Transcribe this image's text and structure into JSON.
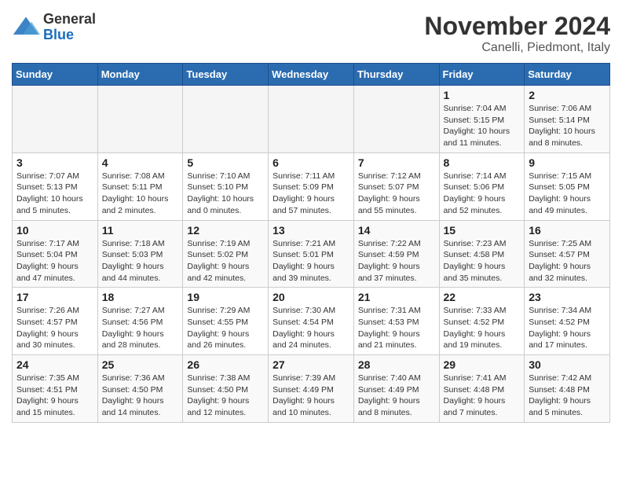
{
  "header": {
    "logo_line1": "General",
    "logo_line2": "Blue",
    "month_title": "November 2024",
    "location": "Canelli, Piedmont, Italy"
  },
  "weekdays": [
    "Sunday",
    "Monday",
    "Tuesday",
    "Wednesday",
    "Thursday",
    "Friday",
    "Saturday"
  ],
  "weeks": [
    [
      {
        "day": "",
        "info": ""
      },
      {
        "day": "",
        "info": ""
      },
      {
        "day": "",
        "info": ""
      },
      {
        "day": "",
        "info": ""
      },
      {
        "day": "",
        "info": ""
      },
      {
        "day": "1",
        "info": "Sunrise: 7:04 AM\nSunset: 5:15 PM\nDaylight: 10 hours and 11 minutes."
      },
      {
        "day": "2",
        "info": "Sunrise: 7:06 AM\nSunset: 5:14 PM\nDaylight: 10 hours and 8 minutes."
      }
    ],
    [
      {
        "day": "3",
        "info": "Sunrise: 7:07 AM\nSunset: 5:13 PM\nDaylight: 10 hours and 5 minutes."
      },
      {
        "day": "4",
        "info": "Sunrise: 7:08 AM\nSunset: 5:11 PM\nDaylight: 10 hours and 2 minutes."
      },
      {
        "day": "5",
        "info": "Sunrise: 7:10 AM\nSunset: 5:10 PM\nDaylight: 10 hours and 0 minutes."
      },
      {
        "day": "6",
        "info": "Sunrise: 7:11 AM\nSunset: 5:09 PM\nDaylight: 9 hours and 57 minutes."
      },
      {
        "day": "7",
        "info": "Sunrise: 7:12 AM\nSunset: 5:07 PM\nDaylight: 9 hours and 55 minutes."
      },
      {
        "day": "8",
        "info": "Sunrise: 7:14 AM\nSunset: 5:06 PM\nDaylight: 9 hours and 52 minutes."
      },
      {
        "day": "9",
        "info": "Sunrise: 7:15 AM\nSunset: 5:05 PM\nDaylight: 9 hours and 49 minutes."
      }
    ],
    [
      {
        "day": "10",
        "info": "Sunrise: 7:17 AM\nSunset: 5:04 PM\nDaylight: 9 hours and 47 minutes."
      },
      {
        "day": "11",
        "info": "Sunrise: 7:18 AM\nSunset: 5:03 PM\nDaylight: 9 hours and 44 minutes."
      },
      {
        "day": "12",
        "info": "Sunrise: 7:19 AM\nSunset: 5:02 PM\nDaylight: 9 hours and 42 minutes."
      },
      {
        "day": "13",
        "info": "Sunrise: 7:21 AM\nSunset: 5:01 PM\nDaylight: 9 hours and 39 minutes."
      },
      {
        "day": "14",
        "info": "Sunrise: 7:22 AM\nSunset: 4:59 PM\nDaylight: 9 hours and 37 minutes."
      },
      {
        "day": "15",
        "info": "Sunrise: 7:23 AM\nSunset: 4:58 PM\nDaylight: 9 hours and 35 minutes."
      },
      {
        "day": "16",
        "info": "Sunrise: 7:25 AM\nSunset: 4:57 PM\nDaylight: 9 hours and 32 minutes."
      }
    ],
    [
      {
        "day": "17",
        "info": "Sunrise: 7:26 AM\nSunset: 4:57 PM\nDaylight: 9 hours and 30 minutes."
      },
      {
        "day": "18",
        "info": "Sunrise: 7:27 AM\nSunset: 4:56 PM\nDaylight: 9 hours and 28 minutes."
      },
      {
        "day": "19",
        "info": "Sunrise: 7:29 AM\nSunset: 4:55 PM\nDaylight: 9 hours and 26 minutes."
      },
      {
        "day": "20",
        "info": "Sunrise: 7:30 AM\nSunset: 4:54 PM\nDaylight: 9 hours and 24 minutes."
      },
      {
        "day": "21",
        "info": "Sunrise: 7:31 AM\nSunset: 4:53 PM\nDaylight: 9 hours and 21 minutes."
      },
      {
        "day": "22",
        "info": "Sunrise: 7:33 AM\nSunset: 4:52 PM\nDaylight: 9 hours and 19 minutes."
      },
      {
        "day": "23",
        "info": "Sunrise: 7:34 AM\nSunset: 4:52 PM\nDaylight: 9 hours and 17 minutes."
      }
    ],
    [
      {
        "day": "24",
        "info": "Sunrise: 7:35 AM\nSunset: 4:51 PM\nDaylight: 9 hours and 15 minutes."
      },
      {
        "day": "25",
        "info": "Sunrise: 7:36 AM\nSunset: 4:50 PM\nDaylight: 9 hours and 14 minutes."
      },
      {
        "day": "26",
        "info": "Sunrise: 7:38 AM\nSunset: 4:50 PM\nDaylight: 9 hours and 12 minutes."
      },
      {
        "day": "27",
        "info": "Sunrise: 7:39 AM\nSunset: 4:49 PM\nDaylight: 9 hours and 10 minutes."
      },
      {
        "day": "28",
        "info": "Sunrise: 7:40 AM\nSunset: 4:49 PM\nDaylight: 9 hours and 8 minutes."
      },
      {
        "day": "29",
        "info": "Sunrise: 7:41 AM\nSunset: 4:48 PM\nDaylight: 9 hours and 7 minutes."
      },
      {
        "day": "30",
        "info": "Sunrise: 7:42 AM\nSunset: 4:48 PM\nDaylight: 9 hours and 5 minutes."
      }
    ]
  ]
}
